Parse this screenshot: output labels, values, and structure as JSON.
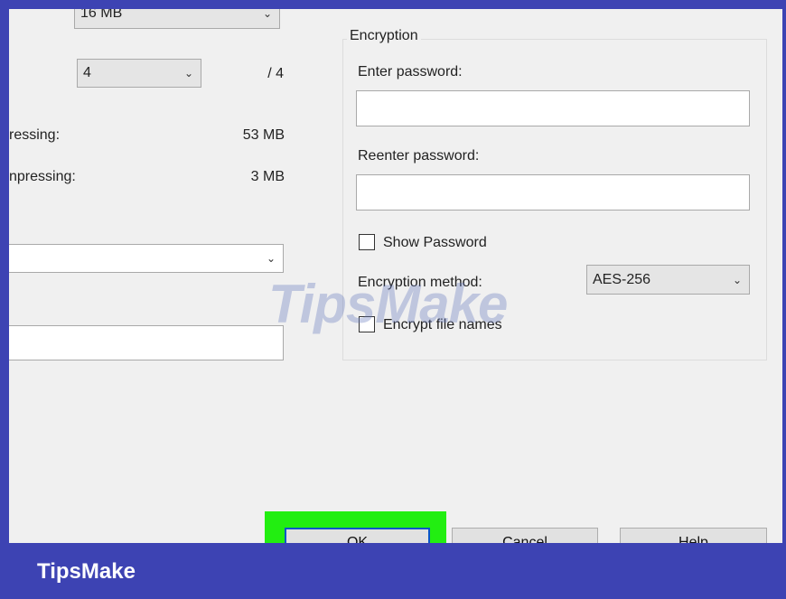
{
  "left_panel": {
    "dictionary_size": "16 MB",
    "threads_value": "4",
    "threads_max": "/ 4",
    "memory_compressing_label": "ressing:",
    "memory_compressing_value": "53 MB",
    "memory_decompressing_label": "npressing:",
    "memory_decompressing_value": "3 MB",
    "split_volumes_value": "",
    "parameters_value": ""
  },
  "encryption": {
    "group_title": "Encryption",
    "enter_password_label": "Enter password:",
    "password_value": "",
    "reenter_password_label": "Reenter password:",
    "reenter_value": "",
    "show_password_label": "Show Password",
    "method_label": "Encryption method:",
    "method_value": "AES-256",
    "encrypt_names_label": "Encrypt file names"
  },
  "buttons": {
    "ok": "OK",
    "cancel": "Cancel",
    "help": "Help"
  },
  "watermark": "TipsMake",
  "footer": {
    "brand": "TipsMake"
  },
  "colors": {
    "highlight": "#22ee11",
    "brand_bar": "#3d43b3",
    "dialog_bg": "#f0f0f0"
  }
}
